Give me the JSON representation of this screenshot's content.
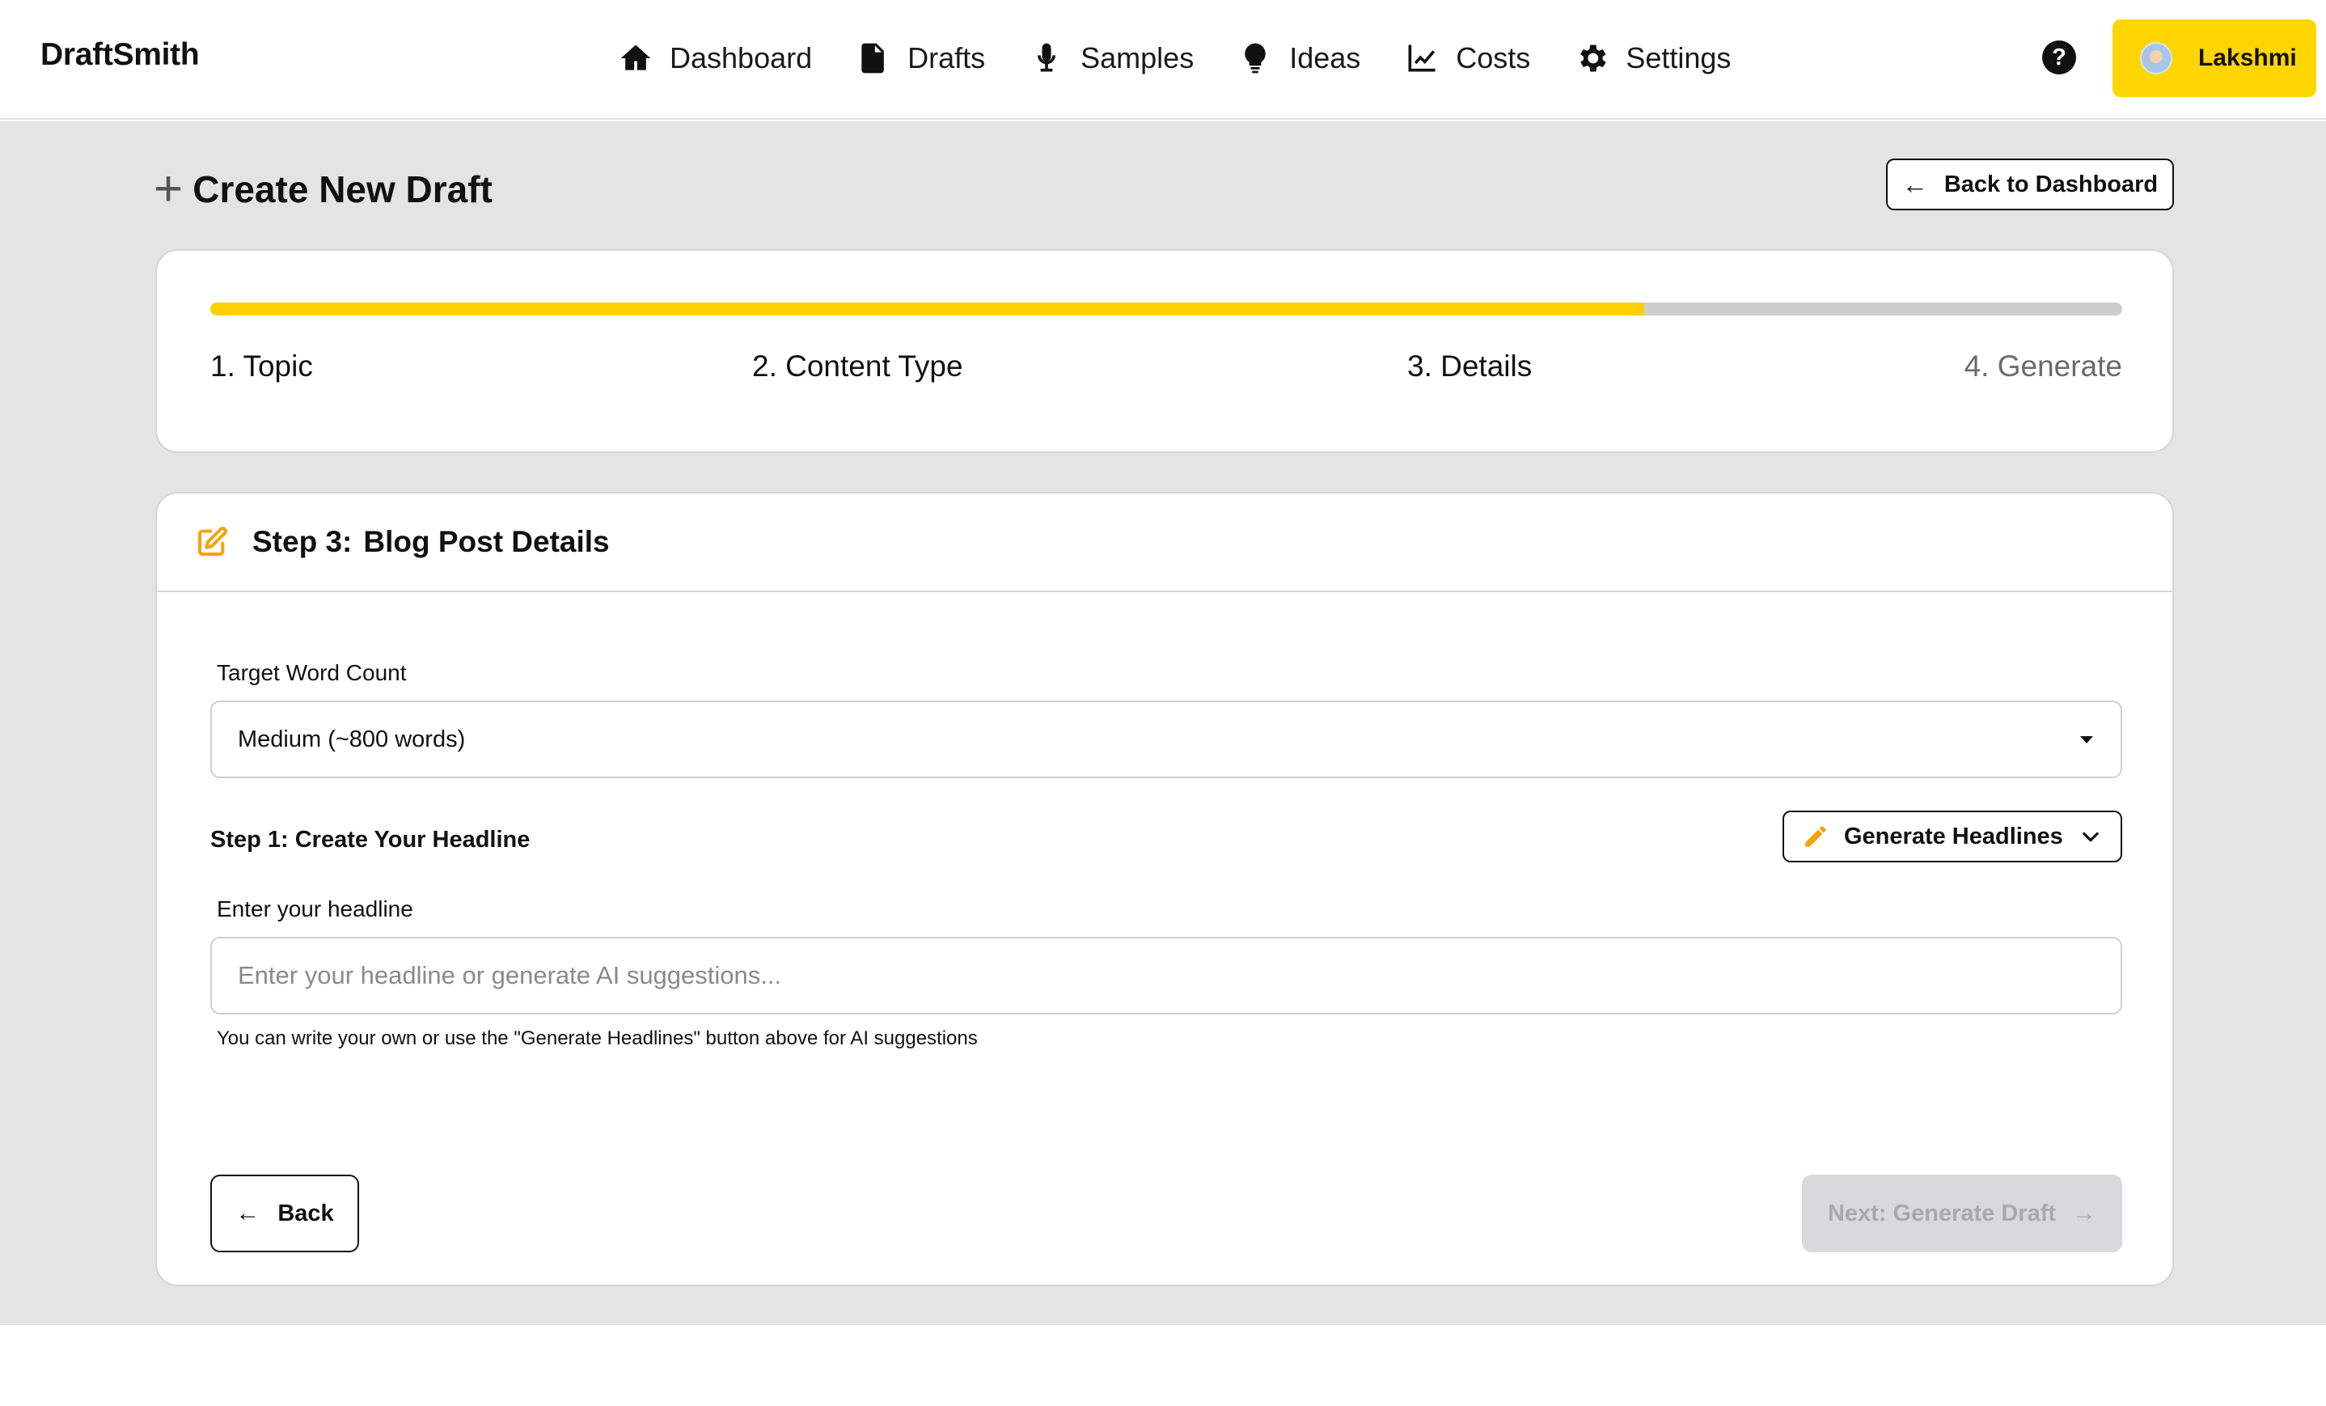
{
  "app": {
    "brand": "DraftSmith"
  },
  "nav": {
    "items": [
      {
        "label": "Dashboard",
        "icon": "home-icon"
      },
      {
        "label": "Drafts",
        "icon": "document-icon"
      },
      {
        "label": "Samples",
        "icon": "microphone-icon"
      },
      {
        "label": "Ideas",
        "icon": "lightbulb-icon"
      },
      {
        "label": "Costs",
        "icon": "chart-line-icon"
      },
      {
        "label": "Settings",
        "icon": "gear-icon"
      }
    ],
    "help_glyph": "?",
    "user_name": "Lakshmi"
  },
  "page": {
    "title": "Create New Draft",
    "back_to_dashboard": "Back to Dashboard"
  },
  "progress": {
    "percent": 75,
    "steps": [
      "1. Topic",
      "2. Content Type",
      "3. Details",
      "4. Generate"
    ],
    "active_step_index": 2
  },
  "details": {
    "step_prefix": "Step 3:",
    "heading": "Blog Post Details",
    "word_count_label": "Target Word Count",
    "word_count_value": "Medium (~800 words)",
    "headline_section": "Step 1: Create Your Headline",
    "generate_headlines": "Generate Headlines",
    "headline_label": "Enter your headline",
    "headline_value": "",
    "headline_placeholder": "Enter your headline or generate AI suggestions...",
    "hint": "You can write your own or use the \"Generate Headlines\" button above for AI suggestions",
    "back": "Back",
    "next": "Next: Generate Draft"
  },
  "colors": {
    "accent": "#ffd500",
    "accent_orange": "#f5a20a",
    "background_gray": "#e4e4e4",
    "disabled_button": "#d9d9dc"
  }
}
